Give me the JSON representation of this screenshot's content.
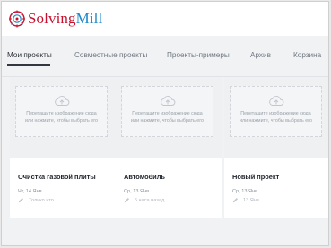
{
  "app": {
    "logo_part1": "Solving",
    "logo_part2": "Mill",
    "brand_red": "#c8102e",
    "brand_blue": "#1e88c8"
  },
  "tabs": [
    {
      "label": "Мои проекты",
      "active": true
    },
    {
      "label": "Совместные проекты",
      "active": false
    },
    {
      "label": "Проекты-примеры",
      "active": false
    },
    {
      "label": "Архив",
      "active": false
    },
    {
      "label": "Корзина",
      "active": false
    }
  ],
  "dropzone": {
    "line1": "Перетащите изображение сюда",
    "line2": "или нажмите, чтобы выбрать его",
    "icon": "cloud-upload-icon"
  },
  "projects": [
    {
      "title": "Очистка газовой плиты",
      "date": "Чт, 14 Янв",
      "edited": "Только что"
    },
    {
      "title": "Автомобиль",
      "date": "Ср, 13 Янв",
      "edited": "5 часа назад"
    },
    {
      "title": "Новый проект",
      "date": "Ср, 13 Янв",
      "edited": "13 Янв"
    }
  ]
}
